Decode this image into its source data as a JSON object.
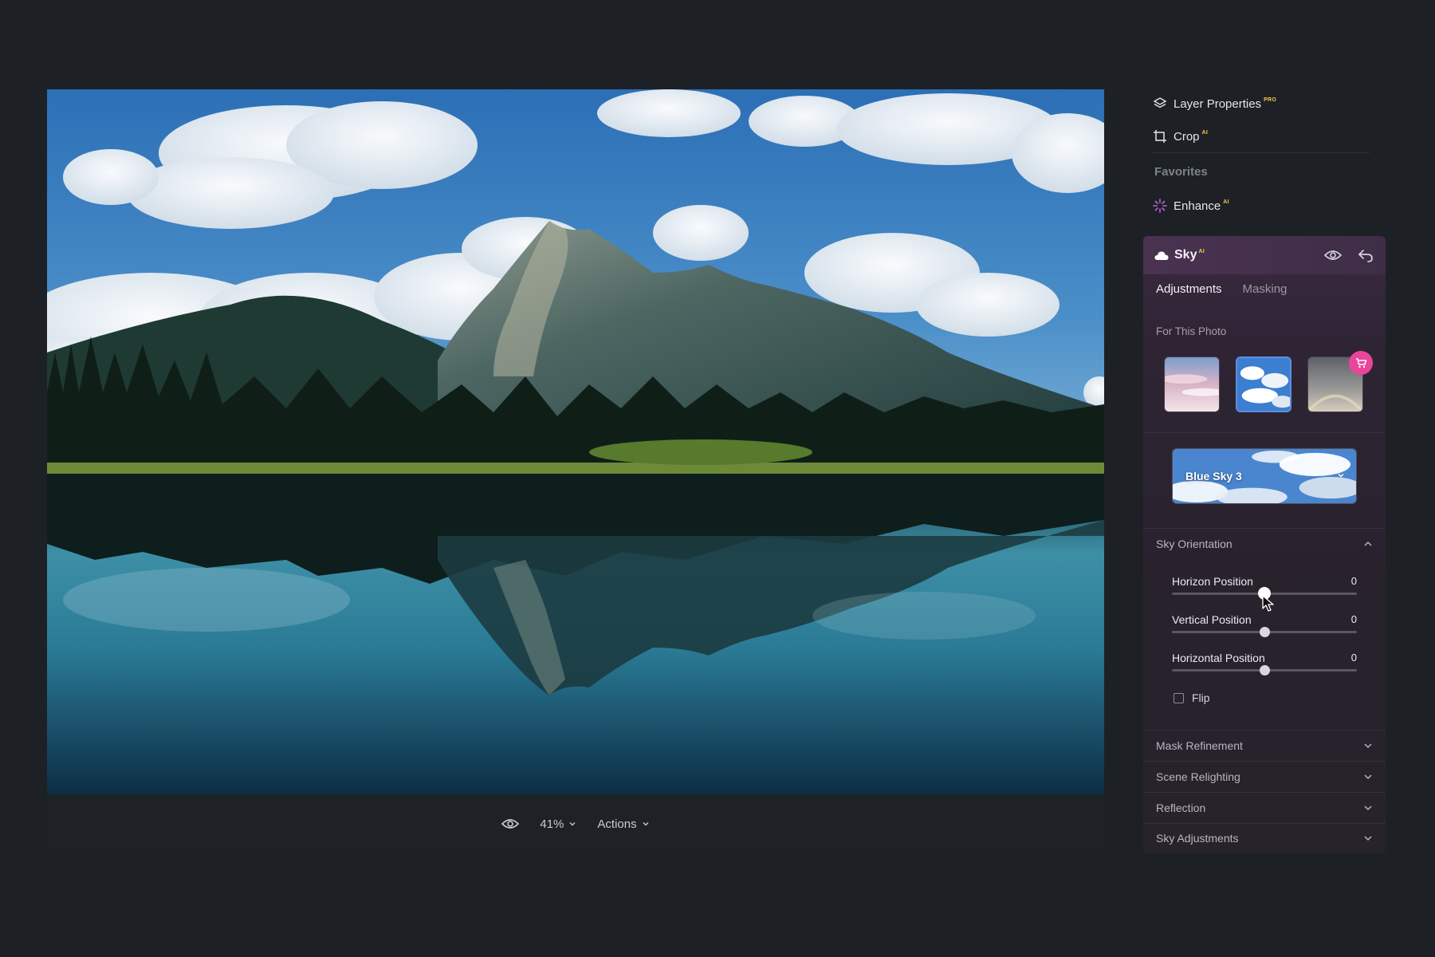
{
  "canvas": {
    "zoom": "41%",
    "actions_label": "Actions"
  },
  "tools": {
    "layer_properties": {
      "label": "Layer Properties",
      "badge": "PRO"
    },
    "crop": {
      "label": "Crop",
      "badge": "AI"
    },
    "favorites_label": "Favorites",
    "enhance": {
      "label": "Enhance",
      "badge": "AI"
    }
  },
  "sky_panel": {
    "title": "Sky",
    "badge": "AI",
    "tabs": [
      "Adjustments",
      "Masking"
    ],
    "active_tab": "Adjustments",
    "for_this_photo": "For This Photo",
    "thumbnails": [
      {
        "name": "pastel-sunset-sky",
        "selected": false
      },
      {
        "name": "blue-cloudy-sky",
        "selected": true
      },
      {
        "name": "rainbow-sky",
        "selected": false
      }
    ],
    "selected_sky": "Blue Sky 3",
    "sky_orientation": {
      "label": "Sky Orientation",
      "expanded": true,
      "sliders": [
        {
          "label": "Horizon Position",
          "value": "0",
          "fraction": 0.5
        },
        {
          "label": "Vertical Position",
          "value": "0",
          "fraction": 0.5
        },
        {
          "label": "Horizontal Position",
          "value": "0",
          "fraction": 0.5
        }
      ],
      "flip_label": "Flip",
      "flip_checked": false
    },
    "collapsed_sections": [
      "Mask Refinement",
      "Scene Relighting",
      "Reflection",
      "Sky Adjustments"
    ]
  },
  "colors": {
    "app_background": "#1d2126",
    "panel_header": "#4a3250",
    "accent_pink": "#e9459b",
    "pro_badge": "#f3c64b",
    "selected_border": "#5e8fe0"
  }
}
